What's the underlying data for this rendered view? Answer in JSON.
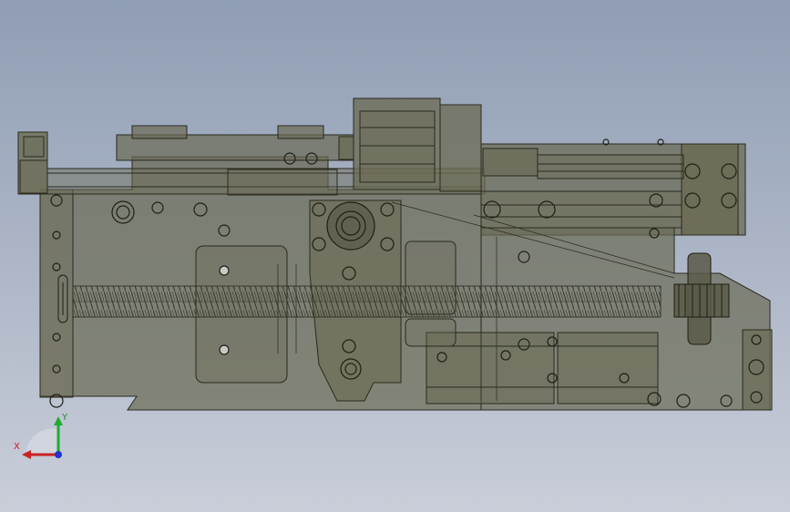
{
  "viewport": {
    "colors": {
      "background_top": "#8f9db5",
      "background_bottom": "#c9ced9",
      "part_fill": "#6b6b55",
      "part_stroke": "#2a2a1e",
      "spring": "#3a3a2c"
    }
  },
  "triad": {
    "x_label": "X",
    "y_label": "Y",
    "x_color": "#cc2222",
    "y_color": "#22aa33",
    "z_color": "#2233cc"
  }
}
